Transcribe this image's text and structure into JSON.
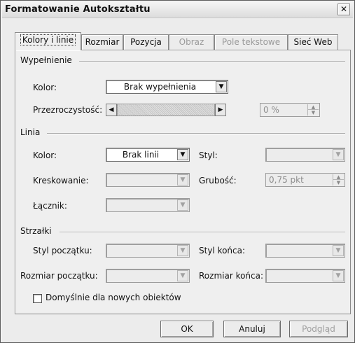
{
  "window": {
    "title": "Formatowanie Autokształtu",
    "close_label": "✕"
  },
  "tabs": [
    {
      "label": "Kolory i linie",
      "active": true
    },
    {
      "label": "Rozmiar"
    },
    {
      "label": "Pozycja"
    },
    {
      "label": "Obraz",
      "disabled": true
    },
    {
      "label": "Pole tekstowe",
      "disabled": true
    },
    {
      "label": "Sieć Web"
    }
  ],
  "fill": {
    "section": "Wypełnienie",
    "color_label": "Kolor:",
    "color_value": "Brak wypełnienia",
    "transparency_label": "Przezroczystość:",
    "transparency_value": "0 %"
  },
  "line": {
    "section": "Linia",
    "color_label": "Kolor:",
    "color_value": "Brak linii",
    "style_label": "Styl:",
    "dash_label": "Kreskowanie:",
    "weight_label": "Grubość:",
    "weight_value": "0,75 pkt",
    "connector_label": "Łącznik:"
  },
  "arrows": {
    "section": "Strzałki",
    "begin_style_label": "Styl początku:",
    "end_style_label": "Styl końca:",
    "begin_size_label": "Rozmiar początku:",
    "end_size_label": "Rozmiar końca:"
  },
  "default_checkbox_label": "Domyślnie dla nowych obiektów",
  "buttons": {
    "ok": "OK",
    "cancel": "Anuluj",
    "preview": "Podgląd"
  },
  "icons": {
    "dropdown": "▼",
    "slider_left": "◀",
    "slider_right": "▶",
    "spin_up": "▲",
    "spin_down": "▼"
  }
}
